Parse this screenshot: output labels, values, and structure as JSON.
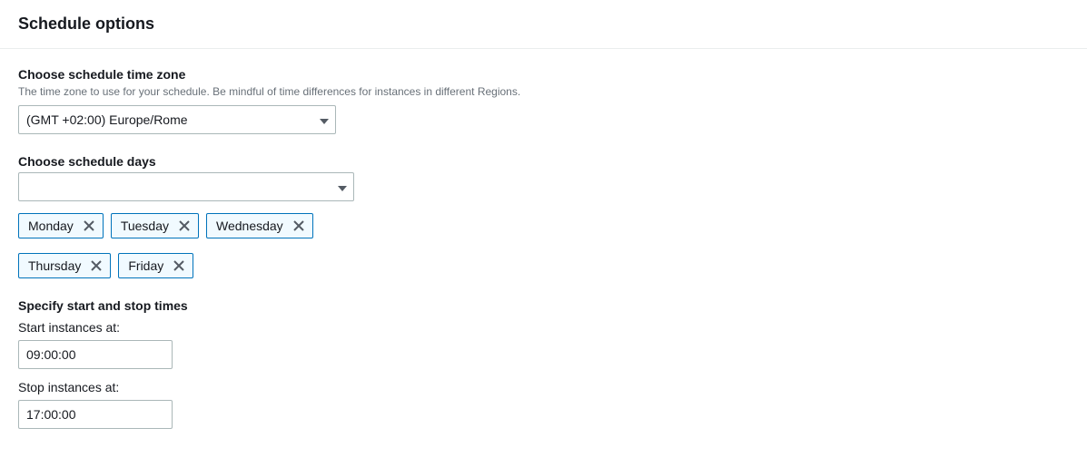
{
  "header": {
    "title": "Schedule options"
  },
  "timezone": {
    "label": "Choose schedule time zone",
    "description": "The time zone to use for your schedule. Be mindful of time differences for instances in different Regions.",
    "selected": "(GMT +02:00) Europe/Rome"
  },
  "days": {
    "label": "Choose schedule days",
    "selected": "",
    "tags": [
      "Monday",
      "Tuesday",
      "Wednesday",
      "Thursday",
      "Friday"
    ]
  },
  "times": {
    "label": "Specify start and stop times",
    "start_label": "Start instances at:",
    "start_value": "09:00:00",
    "stop_label": "Stop instances at:",
    "stop_value": "17:00:00"
  }
}
